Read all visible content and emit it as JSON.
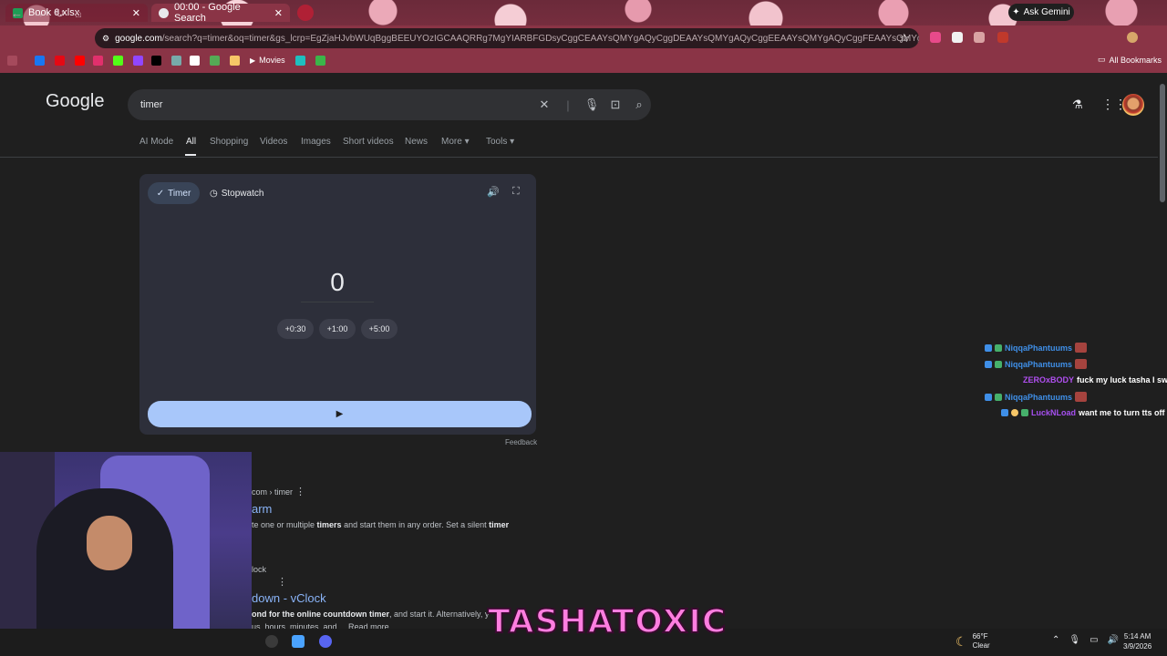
{
  "browser": {
    "tabs": [
      {
        "title": "Book 6.xlsx",
        "favicon_color": "#1f9d55"
      },
      {
        "title": "00:00 - Google Search",
        "favicon_color": "#e8eaed"
      }
    ],
    "ask_gemini": "Ask Gemini",
    "url_host": "google.com",
    "url_rest": "/search?q=timer&oq=timer&gs_lcrp=EgZjaHJvbWUqBggBEEUYOzIGCAAQRRg7MgYIARBFGDsyCggCEAAYsQMYgAQyCggDEAAYsQMYgAQyCggEEAAYsQMYgAQyCggFEAAYsQMYgAQyDQgGEA...",
    "bookmarks": {
      "movies": "Movies",
      "all": "All Bookmarks"
    }
  },
  "google": {
    "logo": "Google",
    "query": "timer",
    "tabs": [
      "AI Mode",
      "All",
      "Shopping",
      "Videos",
      "Images",
      "Short videos",
      "News",
      "More",
      "Tools"
    ],
    "active_tab": "All"
  },
  "timer": {
    "mode_timer": "Timer",
    "mode_stopwatch": "Stopwatch",
    "display": "0",
    "add_30": "+0:30",
    "add_1m": "+1:00",
    "add_5m": "+5:00",
    "feedback": "Feedback"
  },
  "results": {
    "r1_breadcrumb": "com › timer",
    "r1_title": "arm",
    "r1_snippet_a": "te one or multiple ",
    "r1_snippet_b": "timers",
    "r1_snippet_c": " and start them in any order. Set a silent ",
    "r1_snippet_d": "timer",
    "r2_breadcrumb": "lock",
    "r2_title": "down - vClock",
    "r2_snippet_a": "ond for the online countdown timer",
    "r2_snippet_b": ", and start it. Alternatively, y",
    "r2_snippet_c": "us, hours, minutes, and ... Read more"
  },
  "chat": [
    {
      "user": "NiqqaPhantuums",
      "user_color": "#3f8fe8",
      "message": ""
    },
    {
      "user": "NiqqaPhantuums",
      "user_color": "#3f8fe8",
      "message": ""
    },
    {
      "user": "ZEROxBODY",
      "user_color": "#b04ff0",
      "message": "fuck my luck tasha I sw"
    },
    {
      "user": "NiqqaPhantuums",
      "user_color": "#3f8fe8",
      "message": ""
    },
    {
      "user": "LuckNLoad",
      "user_color": "#a64ff0",
      "message": "want me to turn tts off"
    }
  ],
  "overlay": {
    "brand": "TASHATOXIC"
  },
  "taskbar": {
    "weather_temp": "66°F",
    "weather_desc": "Clear",
    "time": "5:14 AM",
    "date": "3/9/2026"
  }
}
